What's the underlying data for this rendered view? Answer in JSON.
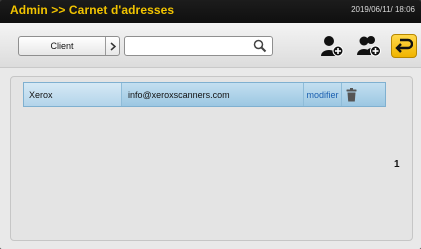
{
  "header": {
    "title": "Admin >> Carnet d'adresses",
    "datetime": "2019/06/11/ 18:06"
  },
  "toolbar": {
    "category_label": "Client",
    "search_value": "",
    "icons": {
      "arrow": "chevron-right-icon",
      "search": "search-icon",
      "add_user": "add-user-icon",
      "add_group": "add-group-icon",
      "back": "back-icon"
    }
  },
  "entries": [
    {
      "name": "Xerox",
      "email": "info@xeroxscanners.com",
      "action": "modifier",
      "delete_icon": "trash-icon"
    }
  ],
  "pager": {
    "page": "1"
  },
  "colors": {
    "title": "#f2c400",
    "row_selected": "#a8cee6",
    "link": "#1a5fb0",
    "back_button": "#f5c518"
  }
}
